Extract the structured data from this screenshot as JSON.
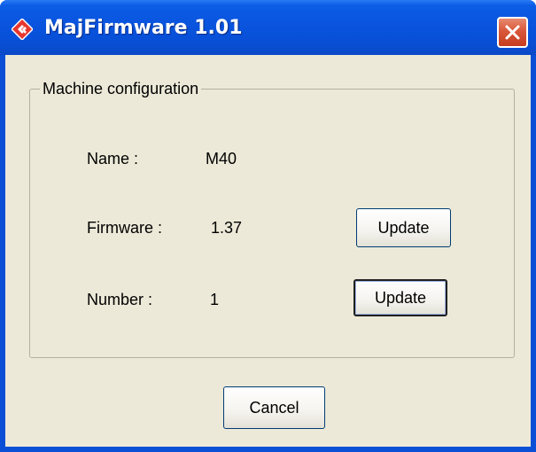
{
  "window": {
    "title": "MajFirmware 1.01"
  },
  "icons": {
    "app": "app-logo-icon",
    "close": "close-icon"
  },
  "machine_config": {
    "legend": "Machine configuration",
    "name_label": "Name :",
    "name_value": "M40",
    "firmware_label": "Firmware :",
    "firmware_value": "1.37",
    "firmware_update_label": "Update",
    "number_label": "Number :",
    "number_value": "1",
    "number_update_label": "Update"
  },
  "footer": {
    "cancel_label": "Cancel"
  },
  "colors": {
    "titlebar": "#0a55df",
    "client_background": "#ece9d8",
    "close_button": "#d9573a",
    "app_icon": "#e8372e"
  }
}
